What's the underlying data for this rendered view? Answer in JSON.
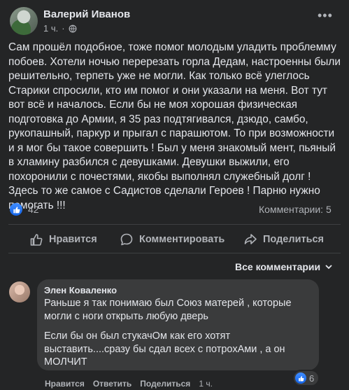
{
  "post": {
    "author": "Валерий Иванов",
    "time": "1 ч.",
    "privacy_icon": "globe-icon",
    "more_icon": "more-dots-icon",
    "text": "Сам прошёл подобное, тоже помог молодым уладить проблемму побоев. Хотели ночью перерезать горла Дедам, настроенны были решительно, терпеть уже не могли. Как только всё улеглось Старики спросили, кто им помог и они указали на меня. Вот тут вот всё и началось. Если бы не моя хорошая физическая подготовка до Армии, я 35 раз подтягивался, дзюдо, самбо, рукопашный, паркур и прыгал с парашютом. То при возможности и я мог бы такое совершить ! Был у меня знакомый мент, пьяный в хламину разбился с девушками. Девушки выжили, его похоронили с почестями, якобы выполнял служебный долг ! Здесь то же самое с Садистов сделали Героев ! Парню нужно помогать !!!",
    "likes_count": "42",
    "comments_count": "Комментарии: 5"
  },
  "actions": {
    "like": "Нравится",
    "comment": "Комментировать",
    "share": "Поделиться"
  },
  "comments_sort": "Все комментарии",
  "comment": {
    "author": "Элен Коваленко",
    "paragraphs": [
      "Раньше я так понимаю был Союз матерей , которые могли с ноги открыть любую дверь",
      "Если бы он был стукачОм как его хотят выставить....сразу бы сдал всех с потрохАми , а он МОЛЧИТ"
    ],
    "reaction_count": "6",
    "like": "Нравится",
    "reply": "Ответить",
    "share": "Поделиться",
    "time": "1 ч."
  },
  "colors": {
    "background": "#242526",
    "bubble": "#3a3b3c",
    "text": "#e4e6eb",
    "secondary_text": "#b0b3b8",
    "like_blue": "#1877f2"
  }
}
